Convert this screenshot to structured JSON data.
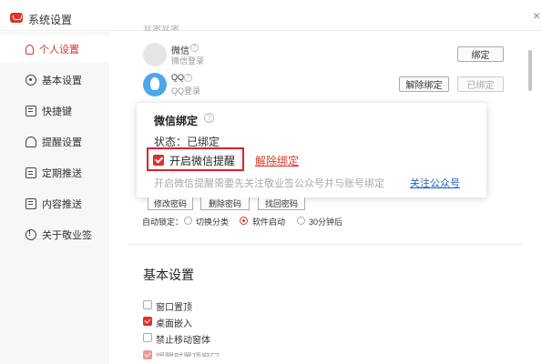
{
  "window": {
    "title": "系统设置",
    "close": "×"
  },
  "sidebar": {
    "items": [
      {
        "label": "个人设置",
        "active": true
      },
      {
        "label": "基本设置"
      },
      {
        "label": "快捷键"
      },
      {
        "label": "提醒设置"
      },
      {
        "label": "定期推送"
      },
      {
        "label": "内容推送"
      },
      {
        "label": "关于敬业签"
      }
    ]
  },
  "login_section": {
    "title_partial": "登录登录",
    "wechat": {
      "name": "微信",
      "sub": "微信登录",
      "bind_button": "绑定"
    },
    "qq": {
      "name": "QQ",
      "sub": "QQ登录",
      "unbind_button": "解除绑定",
      "bound_button": "已绑定"
    }
  },
  "popup": {
    "title": "微信绑定",
    "help": "?",
    "status": "状态：已绑定",
    "reminder_checkbox_label": "开启微信提醒",
    "reminder_checked": true,
    "unbind_link": "解除绑定",
    "note": "开启微信提醒需要先关注敬业签公众号并与账号绑定",
    "follow_link": "关注公众号"
  },
  "password": {
    "buttons": [
      "修改密码",
      "删除密码",
      "找回密码"
    ]
  },
  "autolock": {
    "label": "自动锁定：",
    "options": [
      {
        "label": "切换分类",
        "selected": false
      },
      {
        "label": "软件启动",
        "selected": true
      },
      {
        "label": "30分钟后",
        "selected": false
      }
    ]
  },
  "basic_settings": {
    "title": "基本设置",
    "options": [
      {
        "label": "窗口置顶",
        "checked": false
      },
      {
        "label": "桌面嵌入",
        "checked": true
      },
      {
        "label": "禁止移动窗体",
        "checked": false
      },
      {
        "label": "提醒时置顶窗口",
        "checked": true
      }
    ]
  },
  "colors": {
    "accent": "#d9382a",
    "link_blue": "#1f5fbf"
  }
}
